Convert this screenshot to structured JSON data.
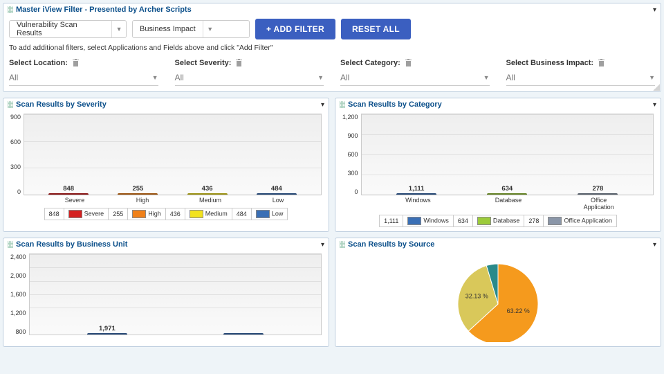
{
  "filterPanel": {
    "title": "Master iView Filter - Presented by Archer Scripts",
    "appCombo": "Vulnerability Scan Results",
    "fieldCombo": "Business Impact",
    "addFilterBtn": "+ ADD FILTER",
    "resetBtn": "RESET ALL",
    "hint": "To add additional filters, select Applications and Fields above and click \"Add Filter\"",
    "filters": [
      {
        "label": "Select Location:",
        "value": "All"
      },
      {
        "label": "Select Severity:",
        "value": "All"
      },
      {
        "label": "Select Category:",
        "value": "All"
      },
      {
        "label": "Select Business Impact:",
        "value": "All"
      }
    ]
  },
  "colors": {
    "severe": "#d42020",
    "high": "#f08018",
    "medium": "#f2e21e",
    "low": "#3a6fb5",
    "windows": "#3a6fb5",
    "database": "#9ccb3a",
    "office": "#8a96a8",
    "bu": "#3a6fb5"
  },
  "chart_data": [
    {
      "id": "severity",
      "title": "Scan Results by Severity",
      "type": "bar",
      "categories": [
        "Severe",
        "High",
        "Medium",
        "Low"
      ],
      "values": [
        848,
        255,
        436,
        484
      ],
      "colors": [
        "severe",
        "high",
        "medium",
        "low"
      ],
      "ylim": [
        0,
        900
      ],
      "yticks": [
        0,
        300,
        600,
        900
      ]
    },
    {
      "id": "category",
      "title": "Scan Results by Category",
      "type": "bar",
      "categories": [
        "Windows",
        "Database",
        "Office Application"
      ],
      "values": [
        1111,
        634,
        278
      ],
      "value_labels": [
        "1,111",
        "634",
        "278"
      ],
      "colors": [
        "windows",
        "database",
        "office"
      ],
      "ylim": [
        0,
        1200
      ],
      "yticks": [
        0,
        300,
        600,
        900,
        1200
      ],
      "ytick_labels": [
        "0",
        "300",
        "600",
        "900",
        "1,200"
      ]
    },
    {
      "id": "bu",
      "title": "Scan Results by Business Unit",
      "type": "bar",
      "categories": [
        "",
        ""
      ],
      "values": [
        1971,
        null
      ],
      "value_labels": [
        "1,971",
        ""
      ],
      "colors": [
        "bu",
        "bu"
      ],
      "ylim": [
        0,
        2400
      ],
      "yticks": [
        800,
        1200,
        1600,
        2000,
        2400
      ],
      "ytick_labels": [
        "800",
        "1,200",
        "1,600",
        "2,000",
        "2,400"
      ]
    },
    {
      "id": "source",
      "title": "Scan Results by Source",
      "type": "pie",
      "slices": [
        {
          "label": "63.22 %",
          "pct": 63.22,
          "color": "#f59a1d"
        },
        {
          "label": "32.13 %",
          "pct": 32.13,
          "color": "#d9c85a"
        },
        {
          "label": "",
          "pct": 4.65,
          "color": "#2a8a8a"
        }
      ]
    }
  ]
}
